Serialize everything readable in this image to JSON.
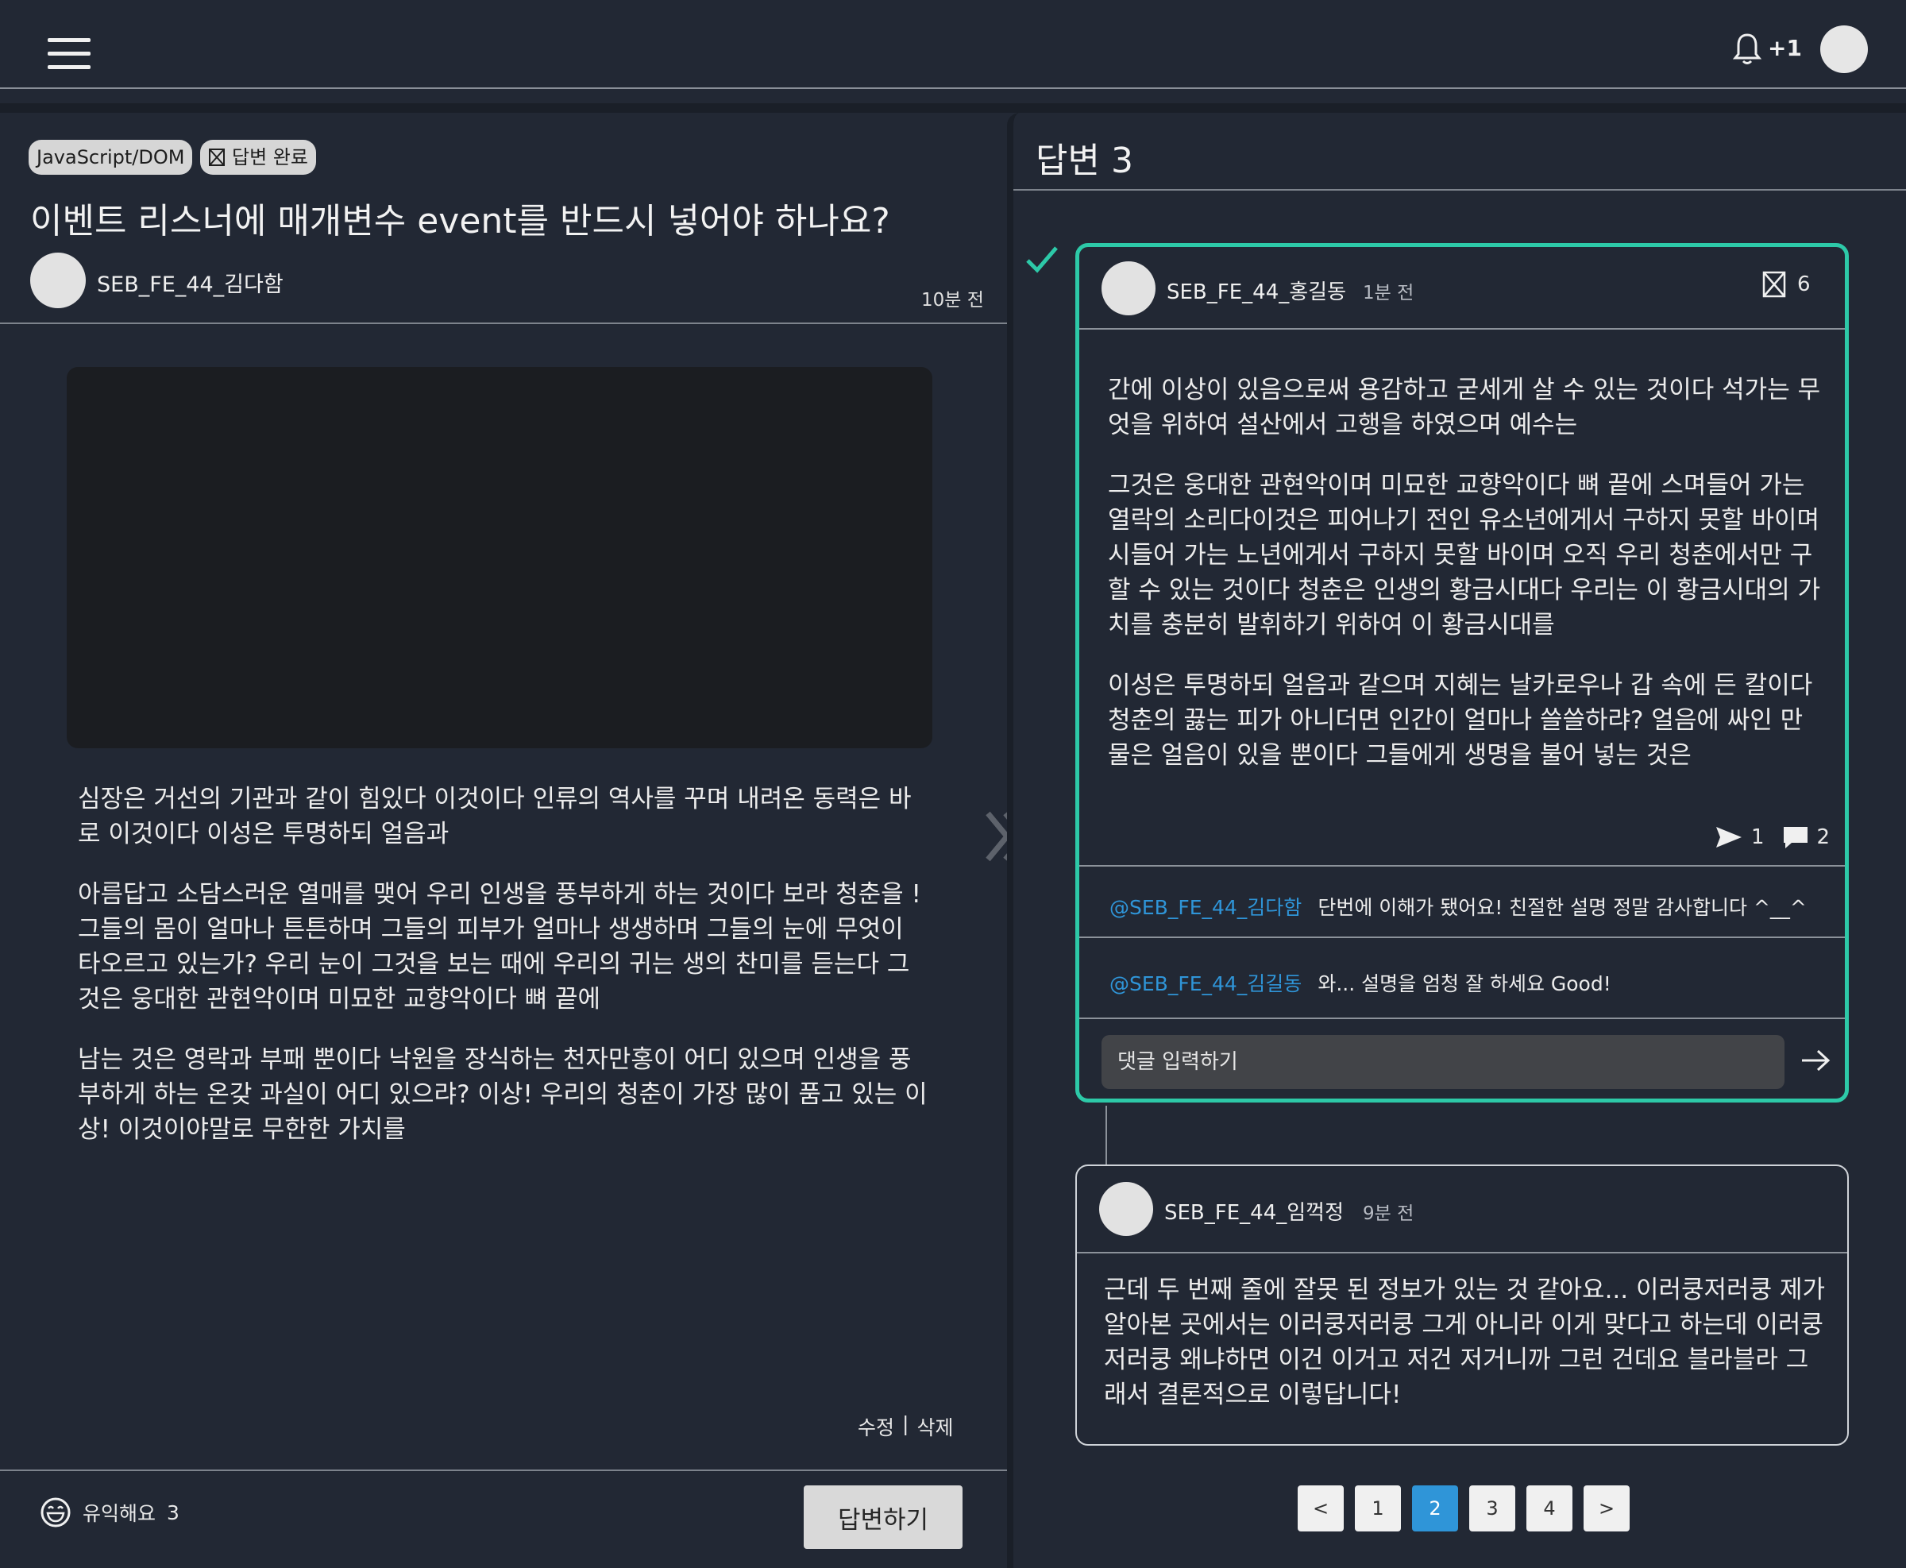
{
  "header": {
    "notification_count": "+1"
  },
  "question": {
    "tags": [
      "JavaScript/DOM"
    ],
    "status_label": "답변 완료",
    "title": "이벤트 리스너에 매개변수 event를 반드시 넣어야 하나요?",
    "author": "SEB_FE_44_김다함",
    "time": "10분 전",
    "paragraphs": [
      "심장은 거선의 기관과 같이 힘있다 이것이다 인류의 역사를 꾸며 내려온 동력은 바로 이것이다 이성은 투명하되 얼음과",
      "아름답고 소담스러운 열매를 맺어 우리 인생을 풍부하게 하는 것이다 보라 청춘을 ! 그들의 몸이 얼마나 튼튼하며 그들의 피부가 얼마나 생생하며 그들의 눈에 무엇이 타오르고 있는가? 우리 눈이 그것을 보는 때에 우리의 귀는 생의 찬미를 듣는다 그것은 웅대한 관현악이며 미묘한 교향악이다 뼈 끝에",
      "남는 것은 영락과 부패 뿐이다 낙원을 장식하는 천자만홍이 어디 있으며 인생을 풍부하게 하는 온갖 과실이 어디 있으랴? 이상! 우리의 청춘이 가장 많이 품고 있는 이상! 이것이야말로 무한한 가치를"
    ],
    "edit_label": "수정",
    "separator": "|",
    "delete_label": "삭제",
    "helpful_label": "유익해요",
    "helpful_count": "3",
    "answer_button": "답변하기"
  },
  "answers": {
    "header": "답변 3",
    "accepted": {
      "author": "SEB_FE_44_홍길동",
      "time": "1분 전",
      "likes": "6",
      "paragraphs": [
        "간에 이상이 있음으로써 용감하고 굳세게 살 수 있는 것이다 석가는 무엇을 위하여 설산에서 고행을 하였으며 예수는",
        "그것은 웅대한 관현악이며 미묘한 교향악이다 뼈 끝에 스며들어 가는 열락의 소리다이것은 피어나기 전인 유소년에게서 구하지 못할 바이며 시들어 가는 노년에게서 구하지 못할 바이며 오직 우리 청춘에서만 구할 수 있는 것이다 청춘은 인생의 황금시대다 우리는 이 황금시대의 가치를 충분히 발휘하기 위하여 이 황금시대를",
        "이성은 투명하되 얼음과 같으며 지혜는 날카로우나 갑 속에 든 칼이다 청춘의 끓는 피가 아니더면 인간이 얼마나 쓸쓸하랴? 얼음에 싸인 만물은 얼음이 있을 뿐이다 그들에게 생명을 불어 넣는 것은"
      ],
      "share_count": "1",
      "comment_count": "2",
      "replies": [
        {
          "mention": "@SEB_FE_44_김다함",
          "text": "단번에 이해가 됐어요! 친절한 설명 정말 감사합니다 ^__^"
        },
        {
          "mention": "@SEB_FE_44_김길동",
          "text": "와... 설명을 엄청 잘 하세요 Good!"
        }
      ],
      "comment_placeholder": "댓글 입력하기"
    },
    "second": {
      "author": "SEB_FE_44_임꺽정",
      "time": "9분 전",
      "body": "근데 두 번째 줄에 잘못 된 정보가 있는 것 같아요... 이러쿵저러쿵 제가 알아본 곳에서는 이러쿵저러쿵 그게 아니라 이게 맞다고 하는데 이러쿵저러쿵 왜냐하면 이건 이거고 저건 저거니까 그런 건데요 블라블라 그래서 결론적으로 이렇답니다!"
    },
    "pagination": {
      "prev": "<",
      "next": ">",
      "pages": [
        "1",
        "2",
        "3",
        "4"
      ],
      "current": "2"
    }
  },
  "colors": {
    "background": "#222834",
    "accepted_border": "#2dc9a8",
    "mention": "#2f95d8",
    "active_page": "#2f95d8"
  },
  "icons": [
    "menu-icon",
    "bell-icon",
    "checkbox-icon",
    "checkmark-icon",
    "double-chevron-right-icon",
    "send-icon",
    "comment-icon",
    "arrow-right-icon",
    "smile-icon"
  ]
}
